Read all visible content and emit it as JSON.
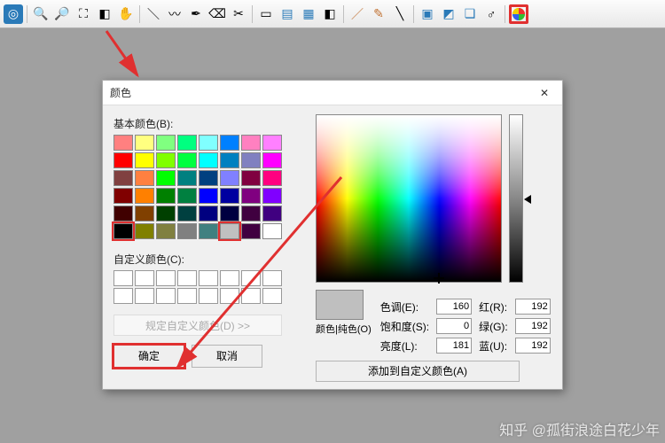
{
  "toolbar": {
    "icons": [
      "app",
      "zoom-in",
      "zoom-out",
      "fit",
      "zoom-region",
      "hand",
      "line",
      "curve",
      "pen",
      "eraser",
      "crop",
      "rect-select",
      "page",
      "text",
      "color-balance",
      "brush",
      "brush2",
      "measure",
      "layers",
      "cube",
      "box3d",
      "connector",
      "color-wheel"
    ]
  },
  "dialog": {
    "title": "颜色",
    "basic_label": "基本颜色(B):",
    "custom_label": "自定义颜色(C):",
    "define_label": "规定自定义颜色(D) >>",
    "ok_label": "确定",
    "cancel_label": "取消",
    "hue_label": "色调(E):",
    "sat_label": "饱和度(S):",
    "lum_label": "亮度(L):",
    "red_label": "红(R):",
    "green_label": "绿(G):",
    "blue_label": "蓝(U):",
    "solid_label": "颜色|纯色(O)",
    "add_label": "添加到自定义颜色(A)",
    "values": {
      "hue": "160",
      "sat": "0",
      "lum": "181",
      "r": "192",
      "g": "192",
      "b": "192"
    }
  },
  "basic_colors": [
    "#ff8080",
    "#ffff80",
    "#80ff80",
    "#00ff80",
    "#80ffff",
    "#0080ff",
    "#ff80c0",
    "#ff80ff",
    "#ff0000",
    "#ffff00",
    "#80ff00",
    "#00ff40",
    "#00ffff",
    "#0080c0",
    "#8080c0",
    "#ff00ff",
    "#804040",
    "#ff8040",
    "#00ff00",
    "#008080",
    "#004080",
    "#8080ff",
    "#800040",
    "#ff0080",
    "#800000",
    "#ff8000",
    "#008000",
    "#008040",
    "#0000ff",
    "#0000a0",
    "#800080",
    "#8000ff",
    "#400000",
    "#804000",
    "#004000",
    "#004040",
    "#000080",
    "#000040",
    "#400040",
    "#400080",
    "#000000",
    "#808000",
    "#808040",
    "#808080",
    "#408080",
    "#c0c0c0",
    "#400040",
    "#ffffff"
  ],
  "selected_basic_index": 40,
  "highlight_basic_index": 45,
  "watermark": "知乎 @孤街浪途白花少年"
}
